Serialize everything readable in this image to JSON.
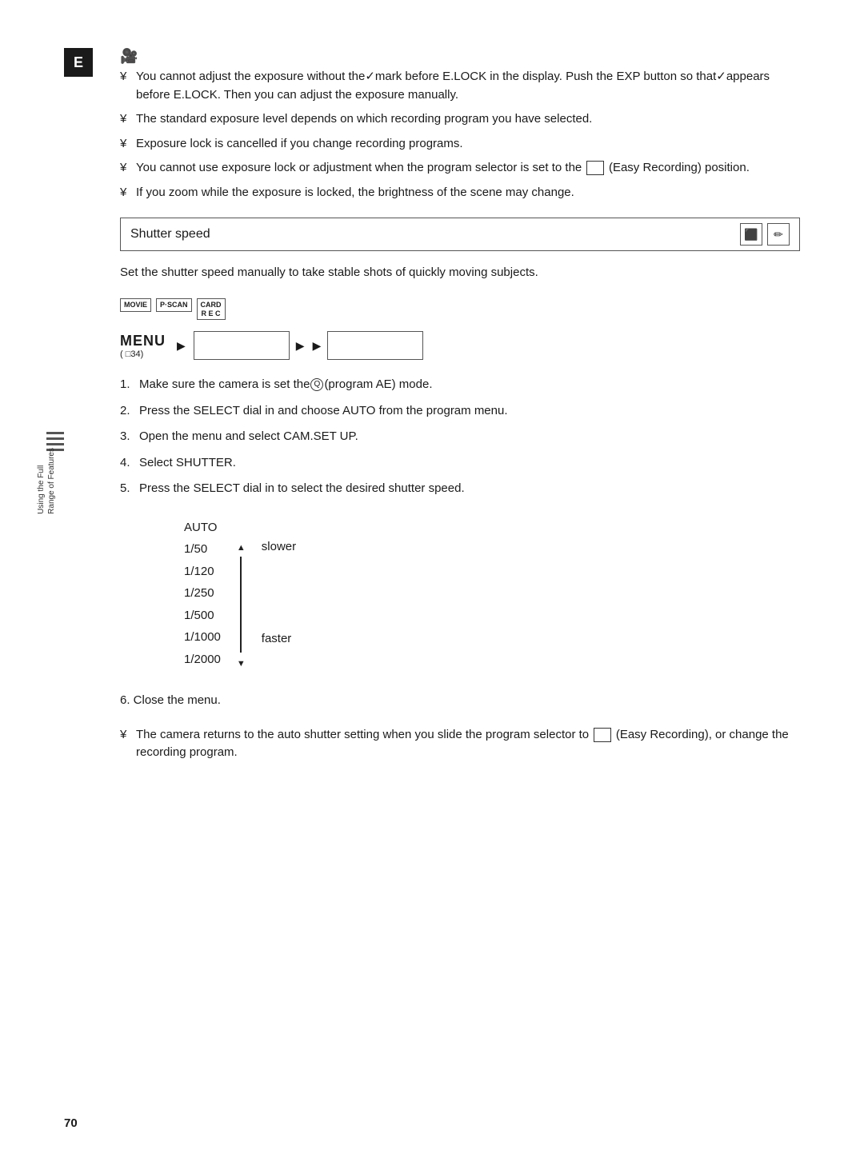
{
  "page": {
    "number": "70",
    "badge": "E"
  },
  "margin_label": {
    "line1": "Using the Full",
    "line2": "Range of Features"
  },
  "top_icon": "📷",
  "notes_top": [
    "You cannot adjust the exposure without the mark before E.LOCK in the display. Push the EXP button so that appears before E.LOCK. Then you can adjust the exposure manually.",
    "The standard exposure level depends on which recording program you have selected.",
    "Exposure lock is cancelled if you change recording programs.",
    "You cannot use exposure lock or adjustment when the program selector is set to the    (Easy Recording) position.",
    "If you zoom while the exposure is locked, the brightness of the scene may change."
  ],
  "section_header": {
    "title": "Shutter speed",
    "icons": [
      "🎞",
      "🎬"
    ]
  },
  "intro": "Set the shutter speed manually to take stable shots of quickly moving subjects.",
  "mode_icons": [
    {
      "label": "MOVIE"
    },
    {
      "label": "P·SCAN"
    },
    {
      "label": "CARD\nR E C"
    }
  ],
  "menu_diagram": {
    "word": "MENU",
    "ref": "( □34)",
    "box1": "",
    "box2": ""
  },
  "steps": [
    {
      "num": "1.",
      "text": "Make sure the camera is set the  (program AE) mode."
    },
    {
      "num": "2.",
      "text": "Press the SELECT dial in and choose AUTO from the program menu."
    },
    {
      "num": "3.",
      "text": "Open the menu and select CAM.SET UP."
    },
    {
      "num": "4.",
      "text": "Select SHUTTER."
    },
    {
      "num": "5.",
      "text": "Press the SELECT dial in to select the desired shutter speed."
    }
  ],
  "shutter_table": {
    "values": [
      "AUTO",
      "1/50",
      "1/120",
      "1/250",
      "1/500",
      "1/1000",
      "1/2000"
    ],
    "label_top": "slower",
    "label_bottom": "faster"
  },
  "step6": "6.  Close the menu.",
  "notes_bottom": [
    "The camera returns to the auto shutter setting when you slide the program selector to    (Easy Recording), or change the recording program."
  ]
}
